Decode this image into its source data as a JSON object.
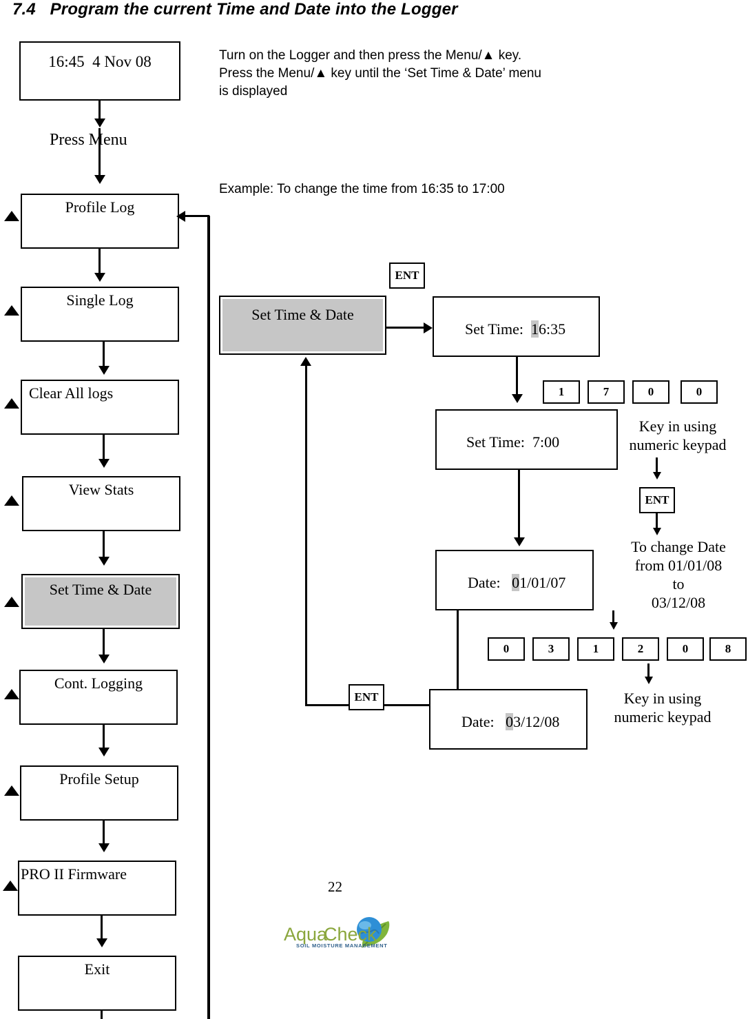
{
  "document": {
    "section_number": "7.4",
    "heading": "7.4   Program the current Time and Date into the Logger",
    "page_number": "22"
  },
  "logger_display": {
    "clock_readout": "16:45  4 Nov 08"
  },
  "press_menu_label": "Press Menu",
  "instructions": {
    "turn_on": "Turn on the Logger and then press the Menu/▲ key.\nPress the Menu/▲ key until the ‘Set Time & Date’ menu\nis displayed",
    "example": "Example: To change the time from 16:35 to 17:00"
  },
  "menu": {
    "items": [
      {
        "label": "Profile Log",
        "selected": false
      },
      {
        "label": "Single Log",
        "selected": false
      },
      {
        "label": "Clear All logs",
        "selected": false
      },
      {
        "label": "View Stats",
        "selected": false
      },
      {
        "label": "Set Time & Date",
        "selected": true
      },
      {
        "label": "Cont. Logging",
        "selected": false
      },
      {
        "label": "Profile Setup",
        "selected": false
      },
      {
        "label": "PRO II Firmware",
        "selected": false
      },
      {
        "label": "Exit",
        "selected": false
      }
    ]
  },
  "flow": {
    "menu_entry": {
      "label": "Set Time & Date",
      "selected": true
    },
    "ent_top": "ENT",
    "ent_mid": "ENT",
    "ent_bottom": "ENT",
    "screens": {
      "set_time_initial": {
        "label": "Set Time:  ",
        "cursor": "1",
        "rest": "6:35"
      },
      "set_time_result": {
        "label": "Set Time:  ",
        "cursor": "",
        "rest": "7:00"
      },
      "date_initial": {
        "label": "Date:   ",
        "cursor": "0",
        "rest": "1/01/07"
      },
      "date_result": {
        "label": "Date:   ",
        "cursor": "0",
        "rest": "3/12/08"
      }
    },
    "time_keys": [
      "1",
      "7",
      "0",
      "0"
    ],
    "date_keys": [
      "0",
      "3",
      "1",
      "2",
      "0",
      "8"
    ],
    "captions": {
      "keypad_time": "Key in using\nnumeric keypad",
      "change_date": "To change Date\nfrom 01/01/08\nto\n03/12/08",
      "keypad_date": "Key in using\nnumeric keypad"
    }
  },
  "branding": {
    "name_part1": "Aqua",
    "name_part2": "Check",
    "tagline": "SOIL MOISTURE MANAGEMENT",
    "colors": {
      "wordmark_green": "#8aa63c",
      "tagline_blue": "#2e5f8a",
      "globe_blue": "#2e8fd6",
      "leaf_green": "#7fb53c"
    }
  }
}
